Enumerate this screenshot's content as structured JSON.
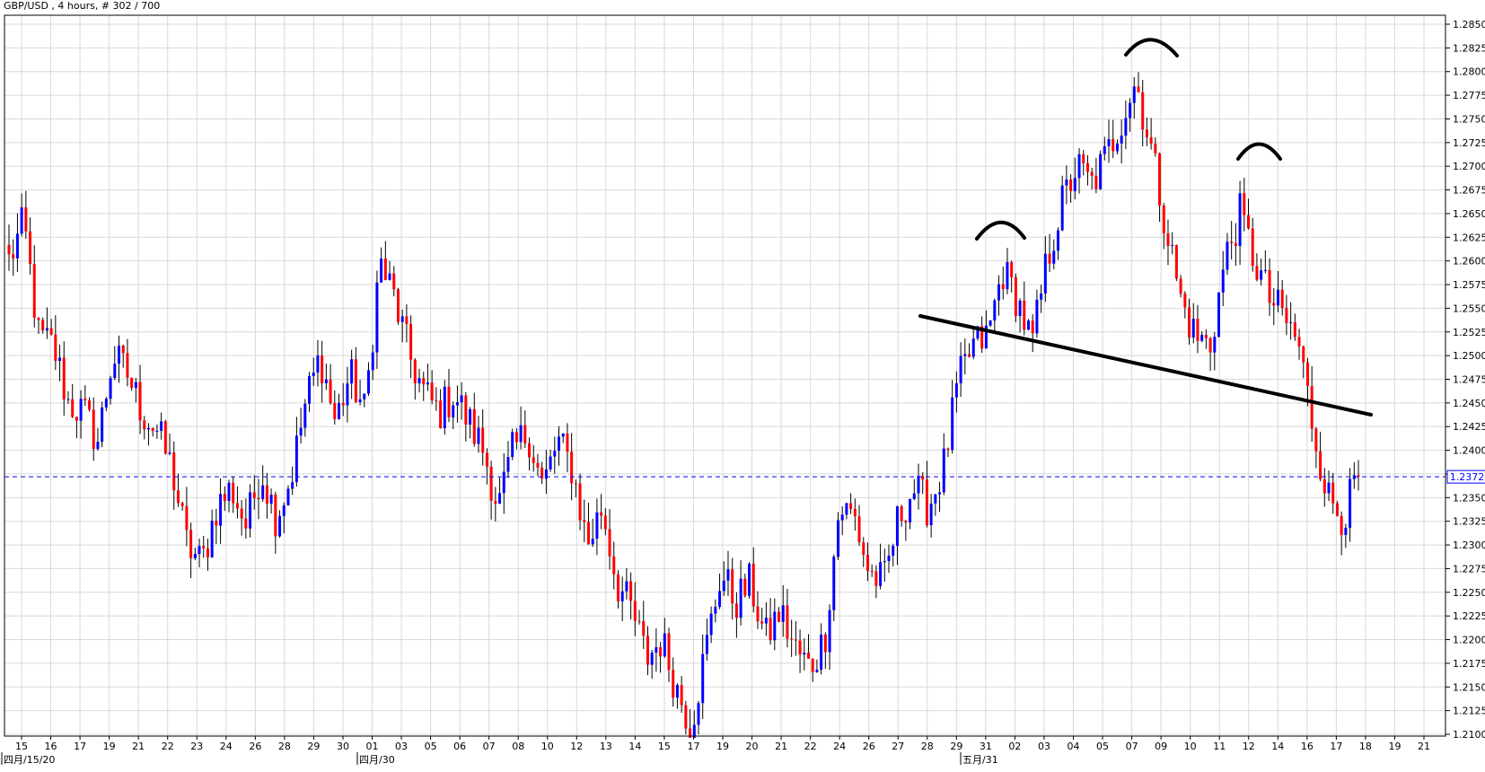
{
  "header": {
    "symbol": "GBP/USD",
    "timeframe": "4 hours",
    "bar_counter": "# 302 / 700"
  },
  "chart_data": {
    "type": "candlestick",
    "title": "GBP/USD , 4 hours, # 302 / 700",
    "ylim": [
      1.21,
      1.285
    ],
    "y_tick_step": 0.0025,
    "grid": true,
    "colors": {
      "up": "#0000ff",
      "down": "#ff0000",
      "wick": "#000000",
      "grid": "#d8d8d8",
      "current_price_line": "#0000ff",
      "annotation": "#000000"
    },
    "current_price": 1.2372,
    "current_price_label": "1.2372",
    "x_ticks": [
      "15",
      "16",
      "17",
      "19",
      "21",
      "22",
      "23",
      "24",
      "26",
      "28",
      "29",
      "30",
      "01",
      "03",
      "05",
      "06",
      "07",
      "08",
      "10",
      "12",
      "13",
      "14",
      "15",
      "17",
      "19",
      "20",
      "21",
      "22",
      "24",
      "26",
      "27",
      "28",
      "29",
      "31",
      "02",
      "03",
      "04",
      "05",
      "07",
      "09",
      "10",
      "11",
      "12",
      "14",
      "16",
      "17",
      "18",
      "19",
      "21"
    ],
    "x_date_labels": [
      "四月/15/20",
      "四月/30",
      "五月/31"
    ],
    "anchor_prices": [
      1.26,
      1.264,
      1.252,
      1.251,
      1.245,
      1.244,
      1.241,
      1.25,
      1.248,
      1.244,
      1.242,
      1.238,
      1.23,
      1.228,
      1.234,
      1.236,
      1.232,
      1.238,
      1.233,
      1.237,
      1.245,
      1.25,
      1.243,
      1.248,
      1.244,
      1.26,
      1.256,
      1.25,
      1.246,
      1.244,
      1.246,
      1.243,
      1.24,
      1.234,
      1.24,
      1.242,
      1.236,
      1.241,
      1.238,
      1.23,
      1.234,
      1.226,
      1.223,
      1.218,
      1.22,
      1.215,
      1.211,
      1.219,
      1.227,
      1.224,
      1.226,
      1.22,
      1.223,
      1.219,
      1.217,
      1.22,
      1.234,
      1.233,
      1.227,
      1.226,
      1.233,
      1.236,
      1.234,
      1.238,
      1.247,
      1.251,
      1.252,
      1.259,
      1.256,
      1.251,
      1.26,
      1.266,
      1.27,
      1.268,
      1.271,
      1.275,
      1.279,
      1.272,
      1.264,
      1.256,
      1.252,
      1.251,
      1.26,
      1.265,
      1.26,
      1.256,
      1.254,
      1.251,
      1.242,
      1.235,
      1.233,
      1.2372
    ]
  }
}
